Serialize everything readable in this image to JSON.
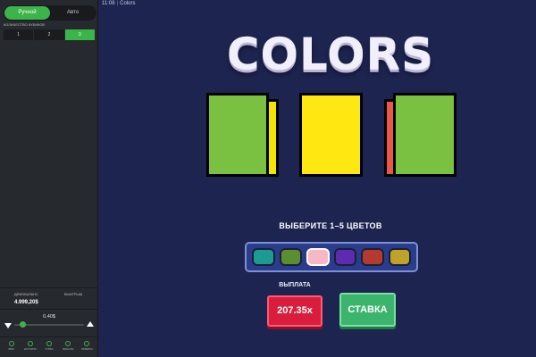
{
  "colors": {
    "accent": "#3bb54a",
    "background": "#1d2450",
    "sidebar": "#262a2e"
  },
  "sidebar": {
    "mode_tabs": [
      {
        "label": "Ручной",
        "active": true
      },
      {
        "label": "Авто",
        "active": false
      }
    ],
    "cube_count_label": "КОЛИЧЕСТВО КУБИКОВ",
    "cube_count_options": [
      {
        "label": "1",
        "active": false
      },
      {
        "label": "2",
        "active": false
      },
      {
        "label": "3",
        "active": true
      }
    ],
    "balance_label": "ДЕМОБАЛАНС",
    "balance_value": "4.999,20$",
    "winnings_label": "ВЫИГРЫШ",
    "winnings_value": "",
    "bet_value": "0,40$",
    "bet_icons": {
      "decrease": "arrow-down-icon",
      "increase": "arrow-up-icon"
    },
    "nav": [
      {
        "label": "ЗВУК",
        "icon": "sound-icon"
      },
      {
        "label": "ИСТОРИЯ",
        "icon": "history-icon"
      },
      {
        "label": "ТУРБО",
        "icon": "turbo-icon"
      },
      {
        "label": "ФИНАЛЫ",
        "icon": "finals-icon"
      },
      {
        "label": "ПРАВИЛА",
        "icon": "rules-icon"
      }
    ]
  },
  "topbar": {
    "time": "11:08",
    "game_name": "Colors"
  },
  "game": {
    "title": "COLORS",
    "cubes": [
      {
        "front": "#7ac142",
        "side": "#f5e400"
      },
      {
        "front": "#ffe812",
        "side": ""
      },
      {
        "front": "#7ac142",
        "side": "#e8584a"
      }
    ],
    "instruction": "ВЫБЕРИТЕ 1–5 ЦВЕТОВ",
    "palette": [
      {
        "color": "#1d9a92",
        "selected": false
      },
      {
        "color": "#5b8e2e",
        "selected": false
      },
      {
        "color": "#f6b8c4",
        "selected": true
      },
      {
        "color": "#5d2bb0",
        "selected": false
      },
      {
        "color": "#b53a2e",
        "selected": false
      },
      {
        "color": "#c0a12a",
        "selected": false
      }
    ],
    "payout_label": "ВЫПЛАТА",
    "payout_value": "207.35x",
    "bet_button_label": "СТАВКА"
  }
}
